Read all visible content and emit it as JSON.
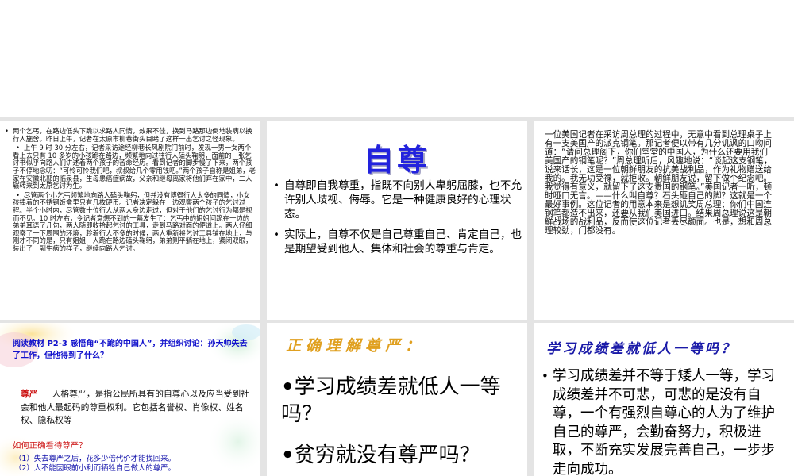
{
  "slide1": {
    "paragraphs": [
      "两个乞丐，在路边低头下跪以求路人同情，效果不佳，换到马路那边倒地装病以换行人施舍。昨日上午，记者在太原市柳巷街头目睹了这样一出乞讨之怪现象。",
      "上午 9 时 30 分左右，记者采访途经柳巷长风剧院门前时，发现一男一女两个看上去只有 10 多岁的小孩跪在路边，频繁地向过往行人磕头鞠躬，面前的一张乞讨书似乎向路人们讲述着两个孩子的苦命经历。看到记者的脚步慢了下来，两个孩子不停地念叨：“可怜可怜我们吧，叔叔给几个零用钱吧。”两个孩子自称是姐弟，老家在安徽北部的临泉县，生母患癌症病故，父亲和继母离家将他们弃在家中，二人辗转来到太原乞讨为生。",
      "尽管两个小乞丐频繁地向路人磕头鞠躬，但并没有博得行人太多的同情，小女孩捧着的不锈钢饭盒里只有几枚硬币。记者决定躲在一边观察两个孩子的乞讨过程。半个小时内，尽管数十位行人从两人身边走过，但对于他们的乞讨行为都是视而不见。10 时左右，令记者意想不到的一幕发生了：乞丐中的姐姐问跪在一边的弟弟耳语了几句，两人随即收拾起乞讨的工具，走到马路对面的便道上。两人仔细观察了一下周围的环境，趁着行人不多的时候，两人重新将乞讨工具铺在地上，与刚才不同的是，只有姐姐一人跪在路边磕头鞠躬，弟弟则平躺在地上，紧闭双眼，装出了一副生病的样子，继续向路人乞讨。"
    ]
  },
  "slide2": {
    "title": "自尊",
    "bullets": [
      "自尊即自我尊重，指既不向别人卑躬屈膝，也不允许别人歧视、侮辱。它是一种健康良好的心理状态。",
      "实际上，自尊不仅是自己尊重自己、肯定自己，也是期望受到他人、集体和社会的尊重与肯定。"
    ]
  },
  "slide3": {
    "text": "一位美国记者在采访周总理的过程中，无意中看到总理桌子上有一支美国产的派克钢笔。那记者便以带有几分讥讽的口吻问道：“请问总理阁下，你们堂堂的中国人，为什么还要用我们美国产的钢笔呢？”周总理听后，风趣地说：“谈起这支钢笔，说来话长，这是一位朝鲜朋友的抗美战利品，作为礼物赠送给我的。我无功受禄，就拒收。朝鲜朋友说，留下做个纪念吧。我觉得有意义，就留下了这支贵国的钢笔。”美国记者一听，顿时哑口无言。——什么叫自尊？石头砸自己的脚？这就是一个最好事例。这位记者的用意本来是想讥笑周总理：你们中国连钢笔都造不出来，还要从我们美国进口。结果周总理说这是朝鲜战场的战利品，反而使这位记者丢尽颜面。也是，想和周总理较劲，门都没有。"
  },
  "slide4": {
    "header": "阅读教材 P2-3 感悟角“不跪的中国人”，并组织讨论：孙天帅失去了工作，但他得到了什么？",
    "term": "尊严",
    "definition": "人格尊严，是指公民所具有的自尊心以及应当受到社会和他人最起码的尊重权利。它包括名誉权、肖像权、姓名权、隐私权等",
    "question": "如何正确看待尊严？",
    "items": [
      "（1）失去尊严之后，花多少倍代价才能找回来。",
      "（2）人不能因眼前小利而牺牲自己做人的尊严。"
    ]
  },
  "slide5": {
    "title": "正确理解尊严：",
    "bullets": [
      "学习成绩差就低人一等吗？",
      "贫穷就没有尊严吗？"
    ],
    "bullet_symbol": "•"
  },
  "slide6": {
    "title": "学习成绩差就低人一等吗？",
    "bullet": "学习成绩差并不等于矮人一等，学习成绩差并不可悲，可悲的是没有自尊，一个有强烈自尊心的人为了维护自己的尊严，会勤奋努力，积极进取，不断充实发展完善自己，一步步走向成功。"
  }
}
